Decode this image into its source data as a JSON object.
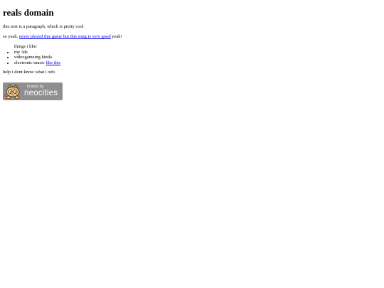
{
  "heading": "reals domain",
  "paragraph1": "this text is a paragraph, which is pretty cool",
  "paragraph2": {
    "before": "so yeah. ",
    "link": "never played this game but this song is very good",
    "after": " yeah!"
  },
  "list": {
    "label": "things i like:",
    "items": {
      "item1": "my 3ds",
      "item2": "videogameing kinda",
      "item3_text": "electronic music ",
      "item3_link": "like this"
    }
  },
  "paragraph3": "help i dont know what i odo",
  "badge": {
    "small_text": "hosted by",
    "brand_text": "neocities",
    "background": "#8f8f8f",
    "icon": "neocities-cat-icon"
  }
}
